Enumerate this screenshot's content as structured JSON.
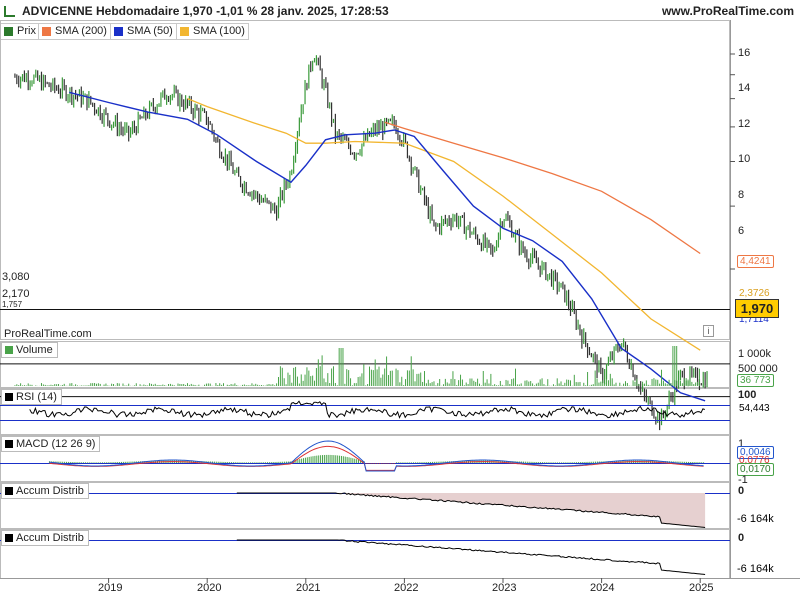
{
  "header": {
    "title": "ADVICENNE Hebdomadaire 1,970 -1,01 % 28 janv. 2025, 17:28:53",
    "site": "www.ProRealTime.com",
    "watermark": "ProRealTime.com",
    "last_price": "1,970",
    "info_glyph": "i"
  },
  "colors": {
    "price_up": "#3a9a3a",
    "price_down": "#333333",
    "sma200": "#ee7744",
    "sma50": "#1a30c8",
    "sma100": "#f2b630",
    "volume": "#49a349",
    "rsi": "#000000",
    "macd": "#2255cc",
    "macd_signal": "#dd3333",
    "accum_fill": "#e6d0d0",
    "last_box": "#ffcc00"
  },
  "legend": {
    "prix": "Prix",
    "sma200": "SMA (200)",
    "sma50": "SMA (50)",
    "sma100": "SMA (100)"
  },
  "panels": {
    "volume": "Volume",
    "rsi": "RSI (14)",
    "macd": "MACD (12 26 9)",
    "accum1": "Accum Distrib",
    "accum2": "Accum Distrib"
  },
  "horizontal_lines": [
    "3,080",
    "2,170",
    "1,757"
  ],
  "value_tags": {
    "sma200": "4,4241",
    "sma100": "2,3726",
    "sma50": "1,7114",
    "volume": "36 773",
    "rsi": "54,443",
    "macd1": "0,0046",
    "macd2": "0,0776",
    "macd3": "0,0170",
    "accum1": "-6 164k",
    "accum2": "-6 164k"
  },
  "chart_data": {
    "type": "line",
    "title": "ADVICENNE Hebdomadaire",
    "x_labels": [
      "2019",
      "2020",
      "2021",
      "2022",
      "2023",
      "2024",
      "2025"
    ],
    "price_axis": {
      "ticks": [
        "16",
        "14",
        "12",
        "10",
        "8",
        "6",
        "4"
      ],
      "ylim": [
        0.5,
        17
      ]
    },
    "volume_axis": {
      "ticks": [
        "1 000k",
        "500 000"
      ]
    },
    "rsi_axis": {
      "ticks": [
        "100"
      ]
    },
    "macd_axis": {
      "ticks": [
        "1",
        "0",
        "-1"
      ]
    },
    "accum_axis": {
      "ticks": [
        "0"
      ]
    },
    "price_series": {
      "x": [
        2018.2,
        2018.4,
        2018.6,
        2018.8,
        2019.0,
        2019.2,
        2019.4,
        2019.6,
        2019.8,
        2020.0,
        2020.1,
        2020.3,
        2020.5,
        2020.7,
        2020.85,
        2021.0,
        2021.08,
        2021.2,
        2021.3,
        2021.5,
        2021.7,
        2021.9,
        2022.0,
        2022.15,
        2022.3,
        2022.5,
        2022.7,
        2022.9,
        2023.0,
        2023.2,
        2023.4,
        2023.6,
        2023.8,
        2024.0,
        2024.2,
        2024.4,
        2024.6,
        2024.8,
        2025.0,
        2025.08
      ],
      "y": [
        13.8,
        13.0,
        12.5,
        11.8,
        10.5,
        9.5,
        11.0,
        12.5,
        11.5,
        10.5,
        9.0,
        7.2,
        6.4,
        5.8,
        7.5,
        13.0,
        16.2,
        12.5,
        9.5,
        8.5,
        9.8,
        10.2,
        9.0,
        6.8,
        5.2,
        5.6,
        5.0,
        4.4,
        5.7,
        4.5,
        4.0,
        3.5,
        2.6,
        2.0,
        2.5,
        1.8,
        1.5,
        2.0,
        1.97,
        1.97
      ]
    },
    "sma200": {
      "x": [
        2021.8,
        2022.0,
        2022.5,
        2023.0,
        2023.5,
        2024.0,
        2024.5,
        2025.0
      ],
      "y": [
        10.3,
        9.9,
        9.0,
        8.2,
        7.4,
        6.6,
        5.5,
        4.42
      ]
    },
    "sma100": {
      "x": [
        2019.8,
        2020.0,
        2020.5,
        2020.8,
        2021.0,
        2021.2,
        2021.5,
        2022.0,
        2022.5,
        2023.0,
        2023.5,
        2024.0,
        2024.5,
        2025.0
      ],
      "y": [
        12.0,
        11.4,
        10.2,
        9.6,
        9.0,
        9.0,
        9.1,
        9.0,
        8.0,
        6.4,
        5.0,
        3.9,
        2.9,
        2.37
      ]
    },
    "sma50": {
      "x": [
        2018.6,
        2019.0,
        2019.4,
        2019.8,
        2020.1,
        2020.5,
        2020.85,
        2021.0,
        2021.2,
        2021.4,
        2021.7,
        2021.9,
        2022.1,
        2022.4,
        2022.7,
        2023.0,
        2023.3,
        2023.6,
        2023.9,
        2024.2,
        2024.5,
        2024.8,
        2025.05
      ],
      "y": [
        12.5,
        11.7,
        11.0,
        10.5,
        9.5,
        8.0,
        7.0,
        7.8,
        9.2,
        9.5,
        9.6,
        9.8,
        9.4,
        7.5,
        6.0,
        5.2,
        4.8,
        4.2,
        3.3,
        2.4,
        2.1,
        1.8,
        1.71
      ]
    },
    "annotations": [
      "3,080",
      "2,170",
      "1,757"
    ]
  }
}
